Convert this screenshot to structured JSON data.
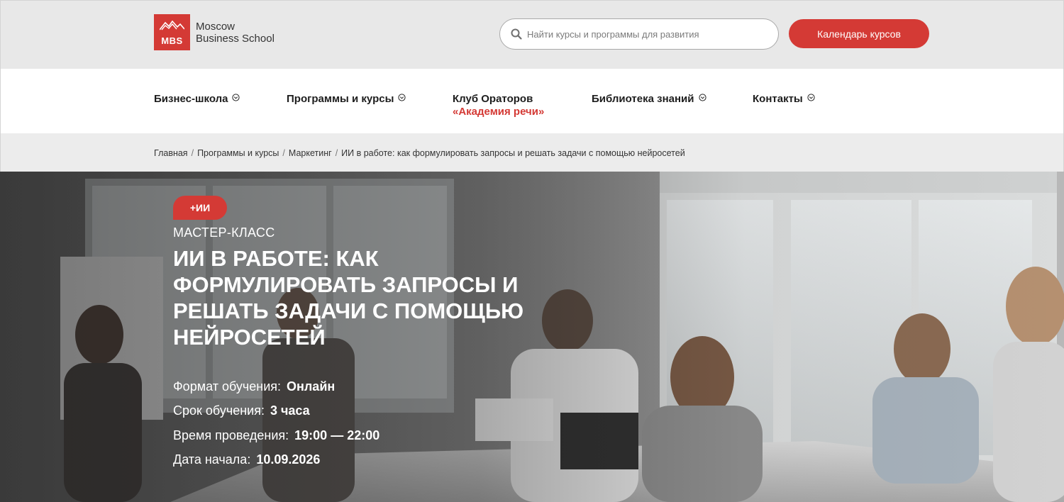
{
  "header": {
    "logo_abbr": "MBS",
    "logo_line1": "Moscow",
    "logo_line2": "Business School",
    "brand_color": "#d43a35",
    "search_placeholder": "Найти курсы и программы для развития",
    "calendar_button": "Календарь курсов"
  },
  "nav": {
    "items": [
      {
        "label": "Бизнес-школа",
        "has_dropdown": true
      },
      {
        "label": "Программы и курсы",
        "has_dropdown": true
      },
      {
        "label": "Клуб Ораторов",
        "accent": "«Академия речи»",
        "has_dropdown": false
      },
      {
        "label": "Библиотека знаний",
        "has_dropdown": true
      },
      {
        "label": "Контакты",
        "has_dropdown": true
      }
    ]
  },
  "breadcrumbs": [
    "Главная",
    "Программы и курсы",
    "Маркетинг",
    "ИИ в работе: как формулировать запросы и решать задачи с помощью нейросетей"
  ],
  "hero": {
    "badge": "+ИИ",
    "kicker": "МАСТЕР-КЛАСС",
    "title": "ИИ в работе: как формулировать запросы и решать задачи с помощью нейросетей",
    "facts": [
      {
        "label": "Формат обучения:",
        "value": "Онлайн"
      },
      {
        "label": "Срок обучения:",
        "value": "3 часа"
      },
      {
        "label": "Время проведения:",
        "value": "19:00 — 22:00"
      },
      {
        "label": "Дата начала:",
        "value": "10.09.2026"
      }
    ]
  }
}
